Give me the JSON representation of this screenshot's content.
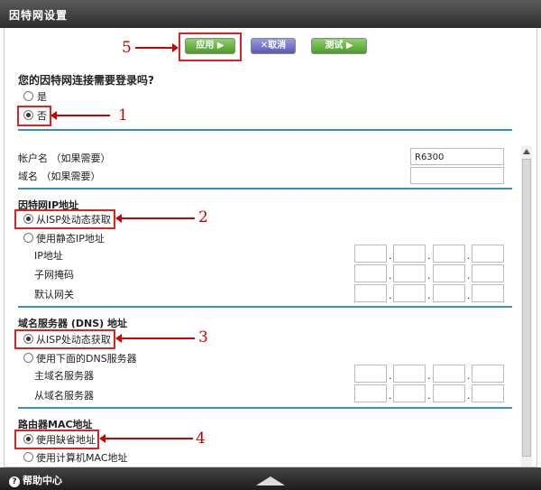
{
  "window": {
    "title": "因特网设置"
  },
  "toolbar": {
    "apply": "应用 ▶",
    "cancel": "✕取消",
    "test": "测试 ▶"
  },
  "login_question": {
    "label": "您的因特网连接需要登录吗?",
    "options": [
      "是",
      "否"
    ],
    "selected": "否"
  },
  "account": {
    "account_label": "帐户名 （如果需要）",
    "account_value": "R6300",
    "domain_label": "域名 （如果需要）",
    "domain_value": ""
  },
  "ip": {
    "section_title": "因特网IP地址",
    "option_dynamic": "从ISP处动态获取",
    "option_static": "使用静态IP地址",
    "ip_label": "IP地址",
    "mask_label": "子网掩码",
    "gateway_label": "默认网关"
  },
  "dns": {
    "section_title": "域名服务器 (DNS) 地址",
    "option_dynamic": "从ISP处动态获取",
    "option_manual": "使用下面的DNS服务器",
    "primary_label": "主域名服务器",
    "secondary_label": "从域名服务器"
  },
  "mac": {
    "section_title": "路由器MAC地址",
    "option_default": "使用缺省地址",
    "option_computer": "使用计算机MAC地址"
  },
  "annotations": [
    "1",
    "2",
    "3",
    "4",
    "5"
  ],
  "footer": {
    "help": "帮助中心"
  }
}
